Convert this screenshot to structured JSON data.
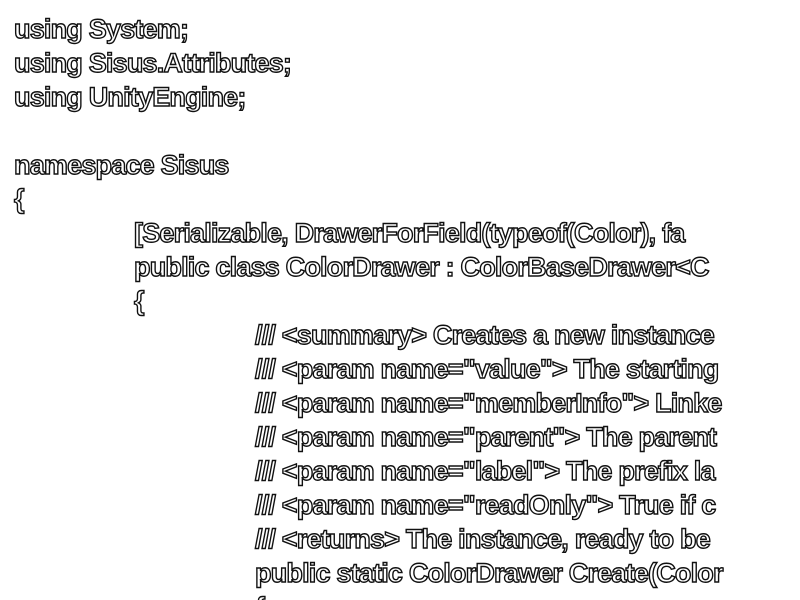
{
  "code": {
    "lines": [
      "using System;",
      "using Sisus.Attributes;",
      "using UnityEngine;",
      "",
      "namespace Sisus",
      "{",
      "[Serializable, DrawerForField(typeof(Color), fa",
      "public class ColorDrawer : ColorBaseDrawer<C",
      "{",
      "/// <summary> Creates a new instance",
      "/// <param name=\"value\"> The starting",
      "/// <param name=\"memberInfo\"> Linke",
      "/// <param name=\"parent\"> The parent",
      "/// <param name=\"label\"> The prefix la",
      "/// <param name=\"readOnly\"> True if c",
      "/// <returns> The instance, ready to be",
      "public static ColorDrawer Create(Color",
      "{"
    ]
  },
  "colors": {
    "text_fill": "#ffffff",
    "text_outline": "#111111",
    "background": "#ffffff"
  }
}
